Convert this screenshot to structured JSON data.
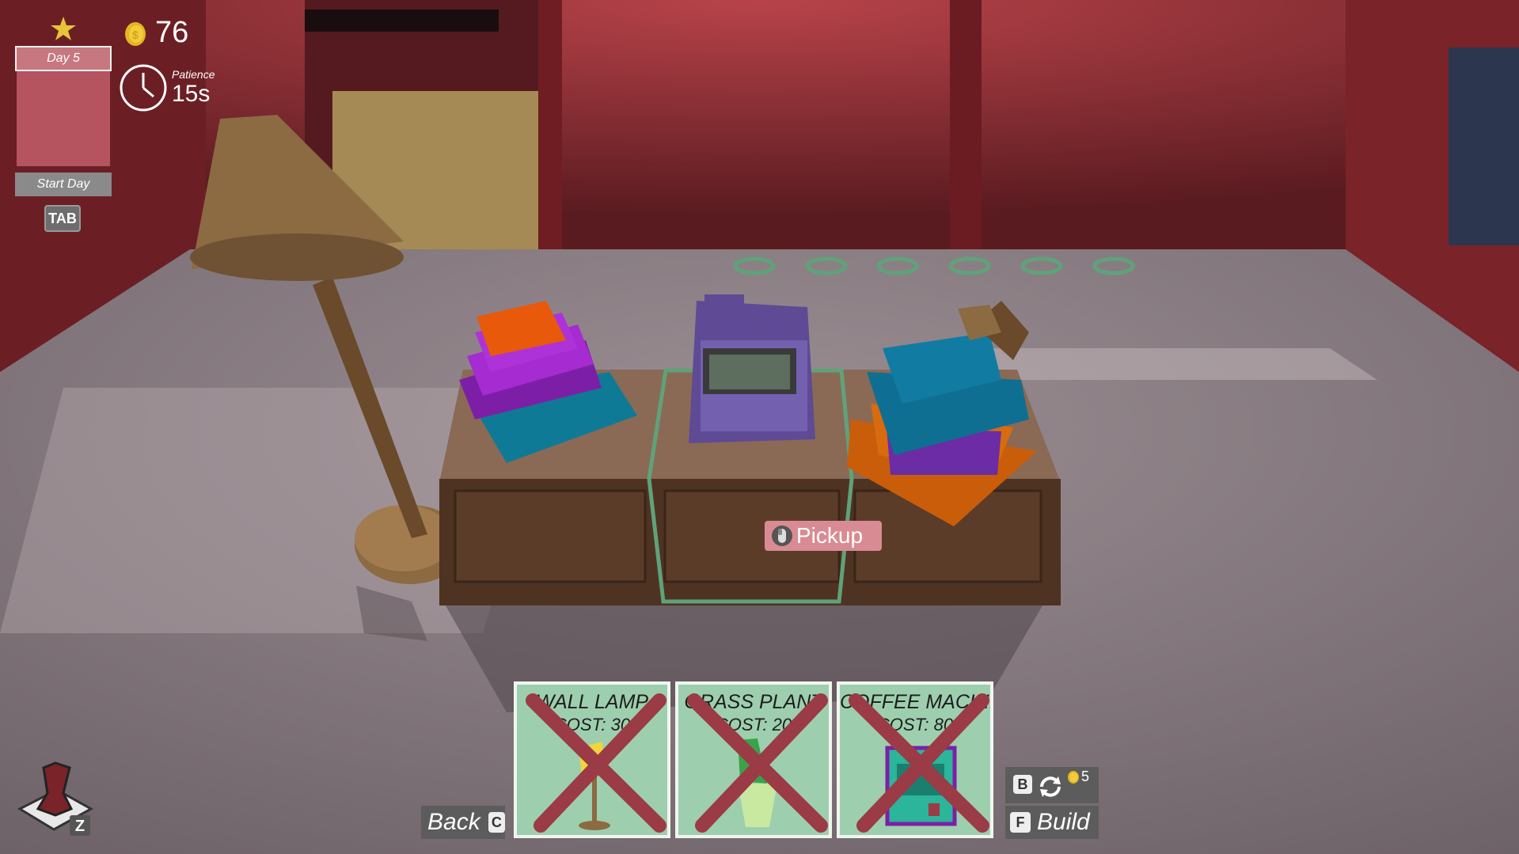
{
  "hud": {
    "day_label": "Day 5",
    "start_day_label": "Start Day",
    "tab_key": "TAB",
    "coins": "76",
    "patience_label": "Patience",
    "patience_value": "15s"
  },
  "prompt": {
    "pickup_label": "Pickup"
  },
  "build_cards": [
    {
      "name": "WALL LAMP",
      "cost": "COST: 30",
      "available": false,
      "icon": "wall-lamp-icon"
    },
    {
      "name": "GRASS PLANT",
      "cost": "COST: 20",
      "available": false,
      "icon": "grass-plant-icon"
    },
    {
      "name": "COFFEE MACHINE",
      "cost": "COST: 80",
      "available": false,
      "icon": "coffee-machine-icon"
    }
  ],
  "controls": {
    "back_label": "Back",
    "back_key": "C",
    "cycle_key": "B",
    "cycle_cost": "5",
    "build_key": "F",
    "build_label": "Build",
    "view_key": "Z"
  },
  "colors": {
    "card_bg": "#9dcfae",
    "cross": "#9b3b45",
    "day_panel": "#b5545e",
    "pickup_bg": "#d98b93",
    "highlight": "#5fa27a"
  }
}
